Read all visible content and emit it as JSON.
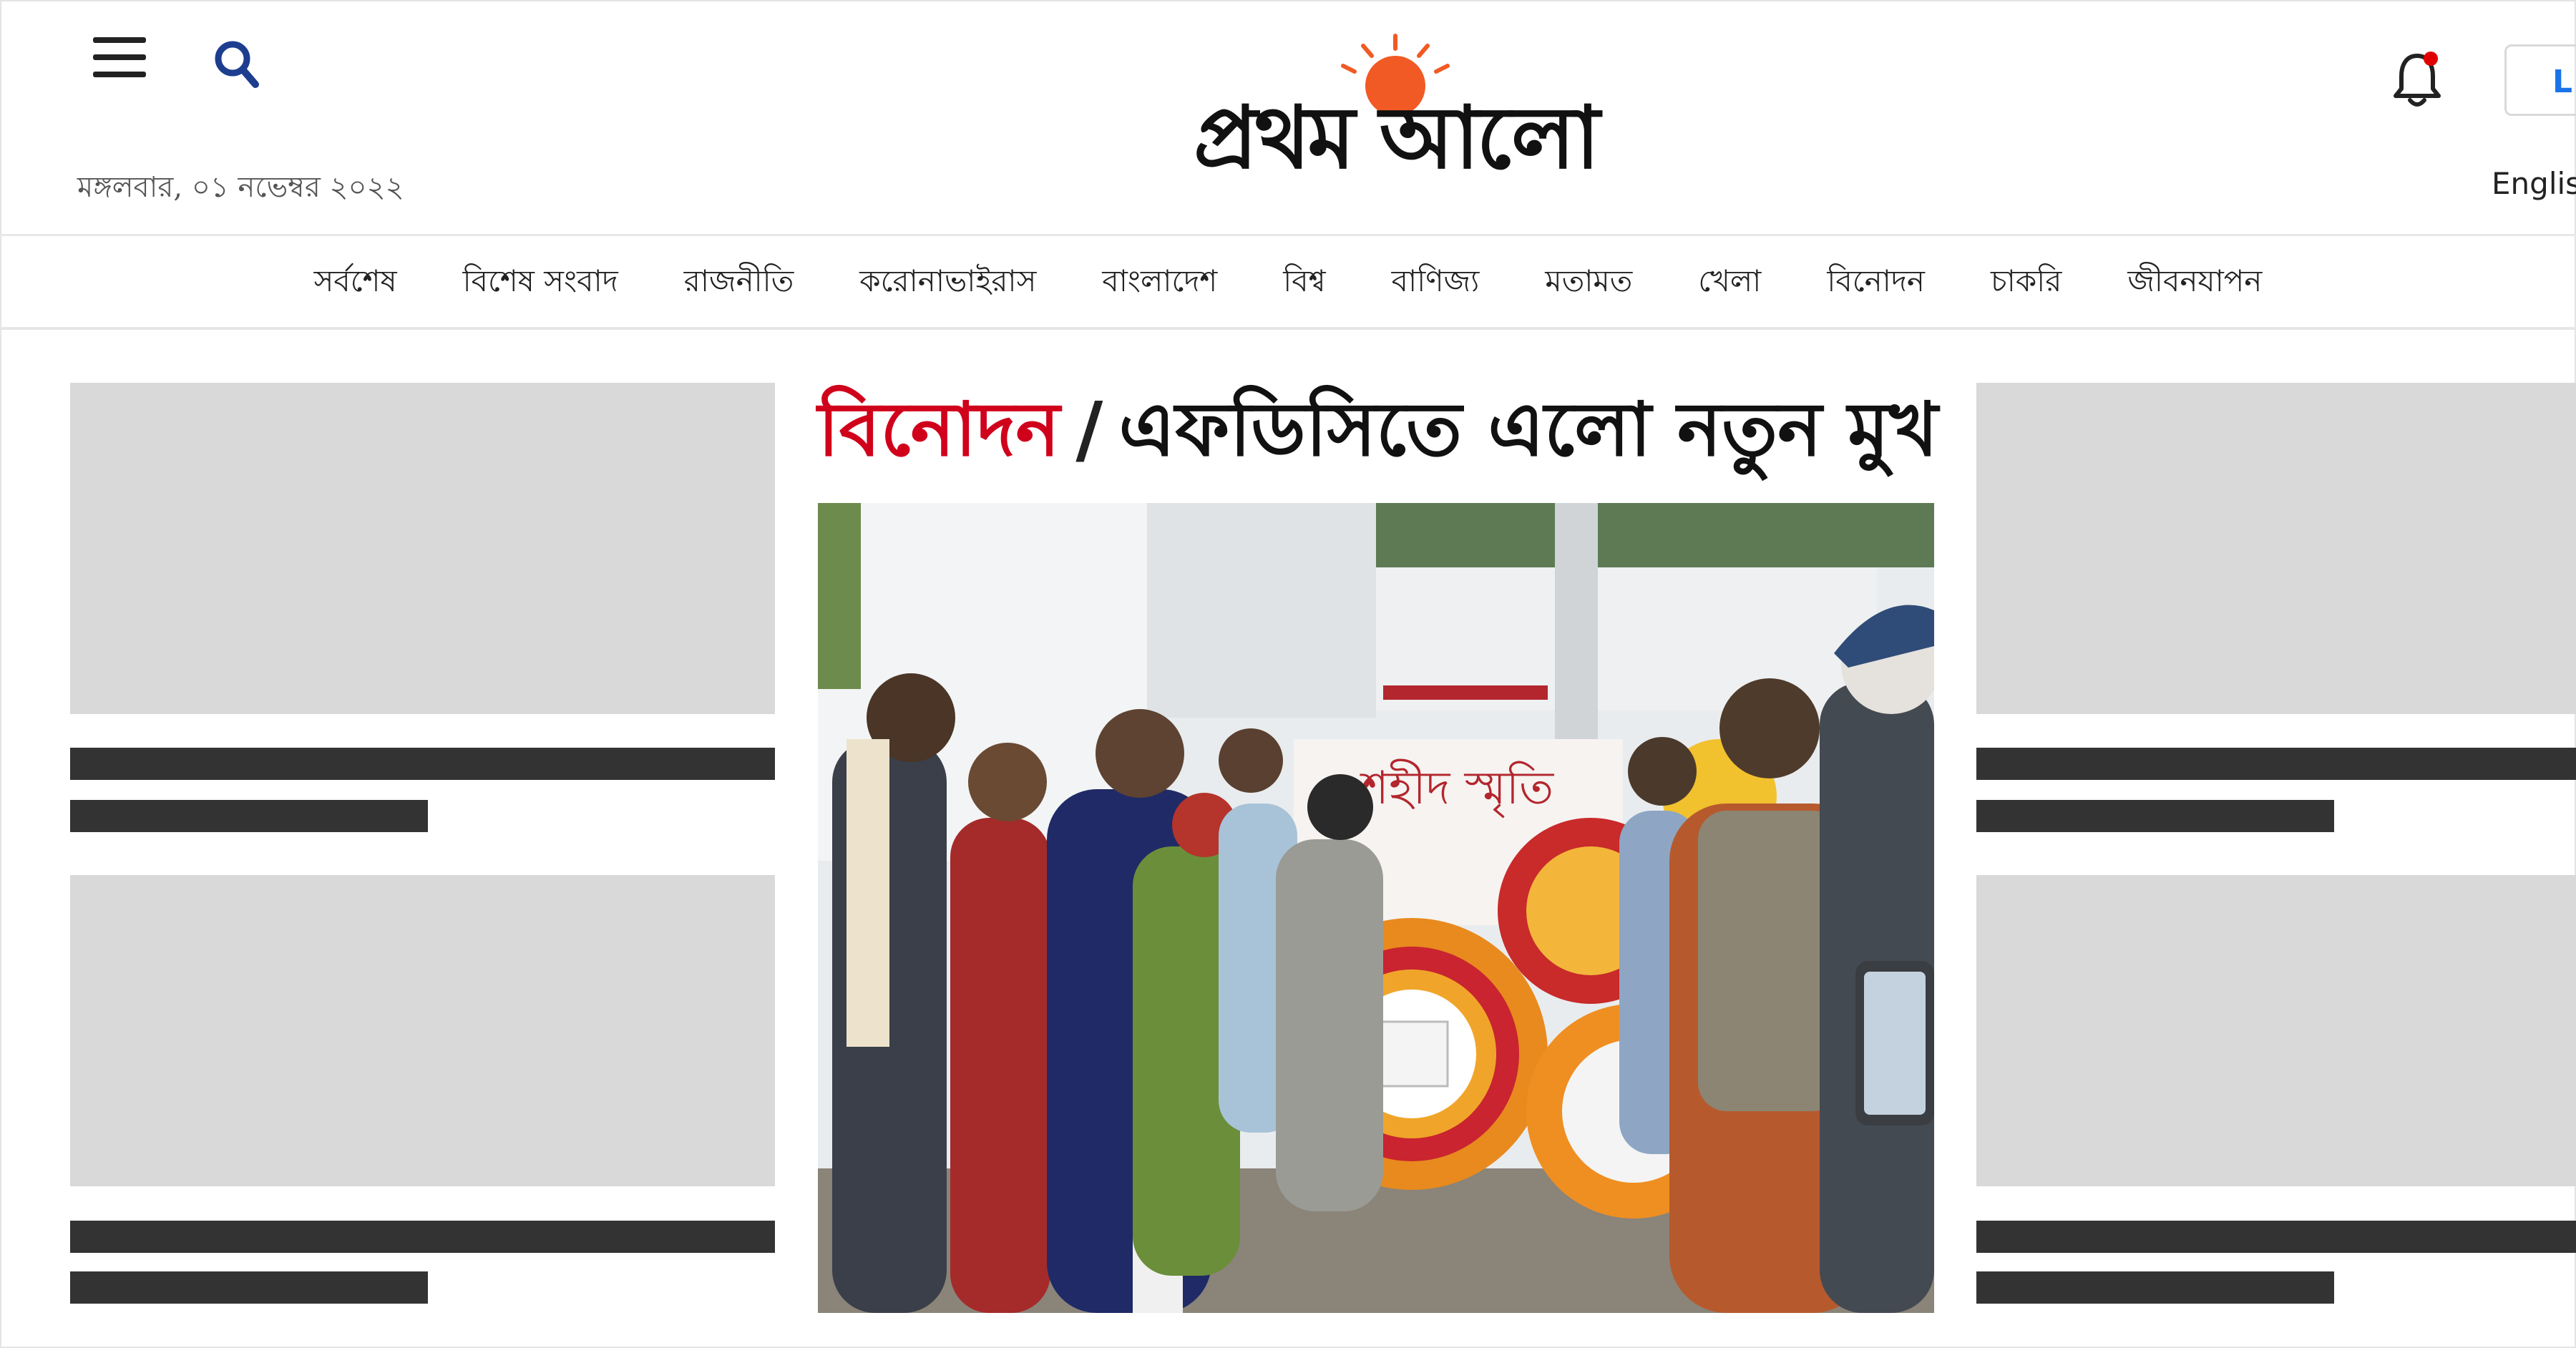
{
  "header": {
    "date": "মঙ্গলবার, ০১ নভেম্বর ২০২২",
    "logo_text": "প্রথম আলো",
    "login_label": "L",
    "english_label": "Englis"
  },
  "nav": {
    "items": [
      {
        "label": "সর্বশেষ"
      },
      {
        "label": "বিশেষ সংবাদ"
      },
      {
        "label": "রাজনীতি"
      },
      {
        "label": "করোনাভাইরাস"
      },
      {
        "label": "বাংলাদেশ"
      },
      {
        "label": "বিশ্ব"
      },
      {
        "label": "বাণিজ্য"
      },
      {
        "label": "মতামত"
      },
      {
        "label": "খেলা"
      },
      {
        "label": "বিনোদন"
      },
      {
        "label": "চাকরি"
      },
      {
        "label": "জীবনযাপন"
      }
    ]
  },
  "article": {
    "category": "বিনোদন",
    "separator": "/",
    "title": "এফডিসিতে এলো নতুন মুখ",
    "photo_banner_text": "শহীদ স্মৃতি"
  },
  "colors": {
    "brand_red": "#d0021b",
    "logo_sun": "#f15a24",
    "placeholder_gray": "#d9d9d9",
    "placeholder_bar": "#333333",
    "link_blue": "#1a73e8"
  },
  "icons": [
    "menu-icon",
    "search-icon",
    "bell-icon",
    "sun-icon"
  ]
}
